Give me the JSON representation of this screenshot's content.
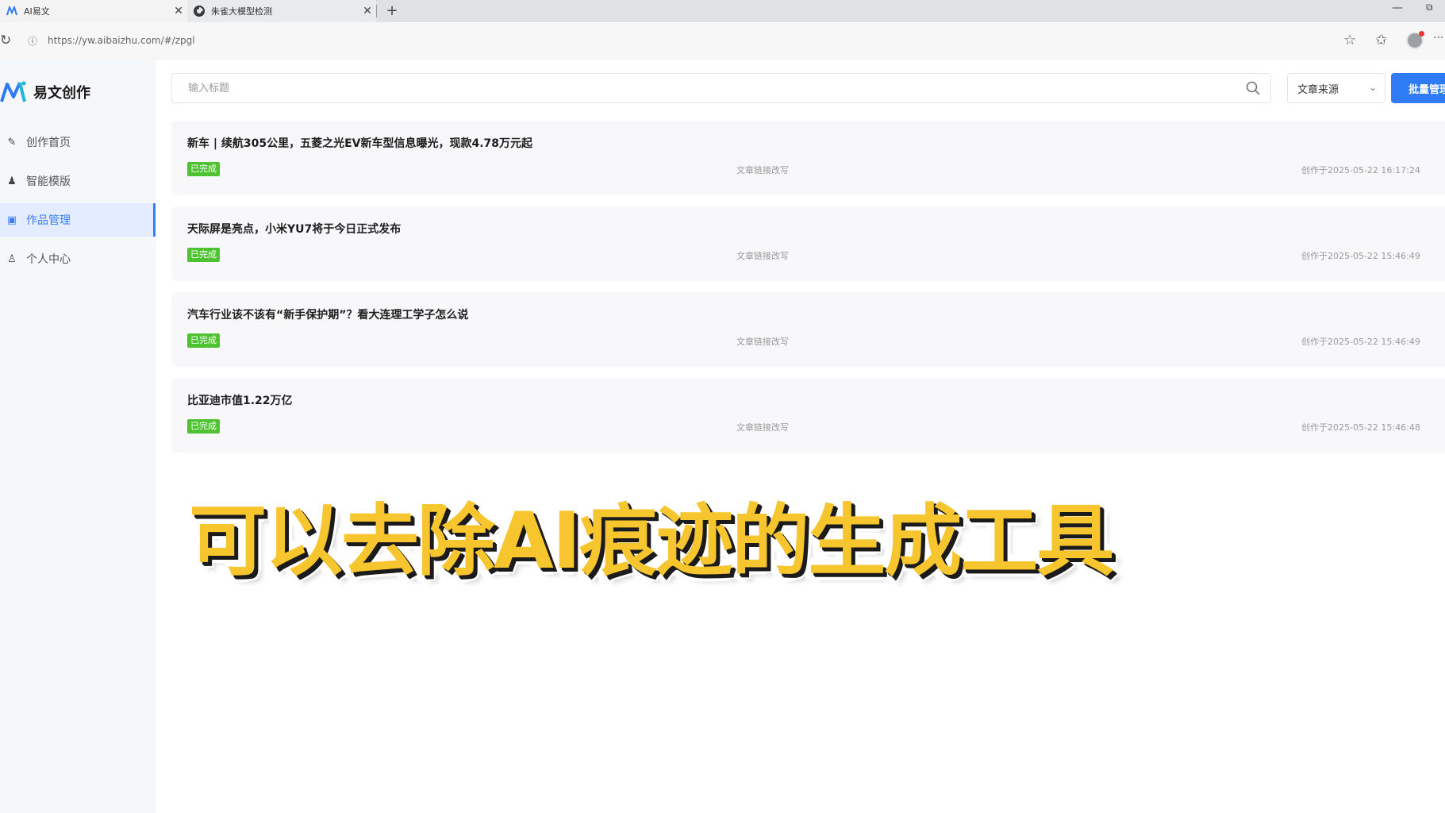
{
  "browser": {
    "tabs": [
      {
        "title": "AI易文",
        "close": "✕"
      },
      {
        "title": "朱雀大模型检测",
        "close": "✕"
      }
    ],
    "new_tab": "+",
    "url": "https://yw.aibaizhu.com/#/zpgl",
    "minimize": "—",
    "restore": "⧉",
    "more": "···"
  },
  "app": {
    "logo_text": "易文创作",
    "nav": [
      {
        "label": "创作首页",
        "icon": "pen-icon"
      },
      {
        "label": "智能模版",
        "icon": "user-magic-icon"
      },
      {
        "label": "作品管理",
        "icon": "folder-icon",
        "active": true
      },
      {
        "label": "个人中心",
        "icon": "person-icon"
      }
    ]
  },
  "toolbar": {
    "search_placeholder": "输入标题",
    "source_label": "文章来源",
    "batch_label": "批量管理"
  },
  "works": [
    {
      "title": "新车 | 续航305公里，五菱之光EV新车型信息曝光，现款4.78万元起",
      "status": "已完成",
      "type": "文章链接改写",
      "time": "创作于2025-05-22 16:17:24"
    },
    {
      "title": "天际屏是亮点，小米YU7将于今日正式发布",
      "status": "已完成",
      "type": "文章链接改写",
      "time": "创作于2025-05-22 15:46:49"
    },
    {
      "title": "汽车行业该不该有“新手保护期”？看大连理工学子怎么说",
      "status": "已完成",
      "type": "文章链接改写",
      "time": "创作于2025-05-22 15:46:49"
    },
    {
      "title": "比亚迪市值1.22万亿",
      "status": "已完成",
      "type": "文章链接改写",
      "time": "创作于2025-05-22 15:46:48"
    }
  ],
  "caption": "可以去除AI痕迹的生成工具",
  "colors": {
    "accent": "#2f7bf5",
    "status_green": "#4fc232",
    "caption_yellow": "#f7c52d"
  }
}
